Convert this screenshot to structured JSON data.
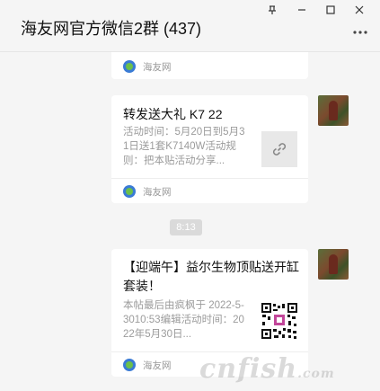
{
  "window": {
    "title": "海友网官方微信2群 (437)",
    "pin_label": "⊥",
    "minimize_label": "—",
    "maximize_label": "☐",
    "close_label": "✕"
  },
  "messages": [
    {
      "type": "card-footer-only",
      "source": "海友网"
    },
    {
      "type": "link-card",
      "title": "转发送大礼 K7 22",
      "description": "活动时间：5月20日到5月31日送1套K7140W活动规则：把本贴活动分享...",
      "source": "海友网",
      "thumb_icon": "link-icon"
    },
    {
      "type": "time",
      "text": "8:13"
    },
    {
      "type": "qr-card",
      "title": "【迎端午】益尔生物顶贴送开缸套装！",
      "description": "本帖最后由疯枫于 2022-5-3010:53编辑活动时间：2022年5月30日...",
      "source": "海友网",
      "thumb_icon": "qr-code-icon"
    }
  ],
  "watermark": {
    "text": "cnfish",
    "suffix": ".com"
  },
  "colors": {
    "background": "#f5f5f5",
    "card": "#ffffff",
    "muted_text": "#9b9b9b",
    "time_badge": "#dadada"
  }
}
